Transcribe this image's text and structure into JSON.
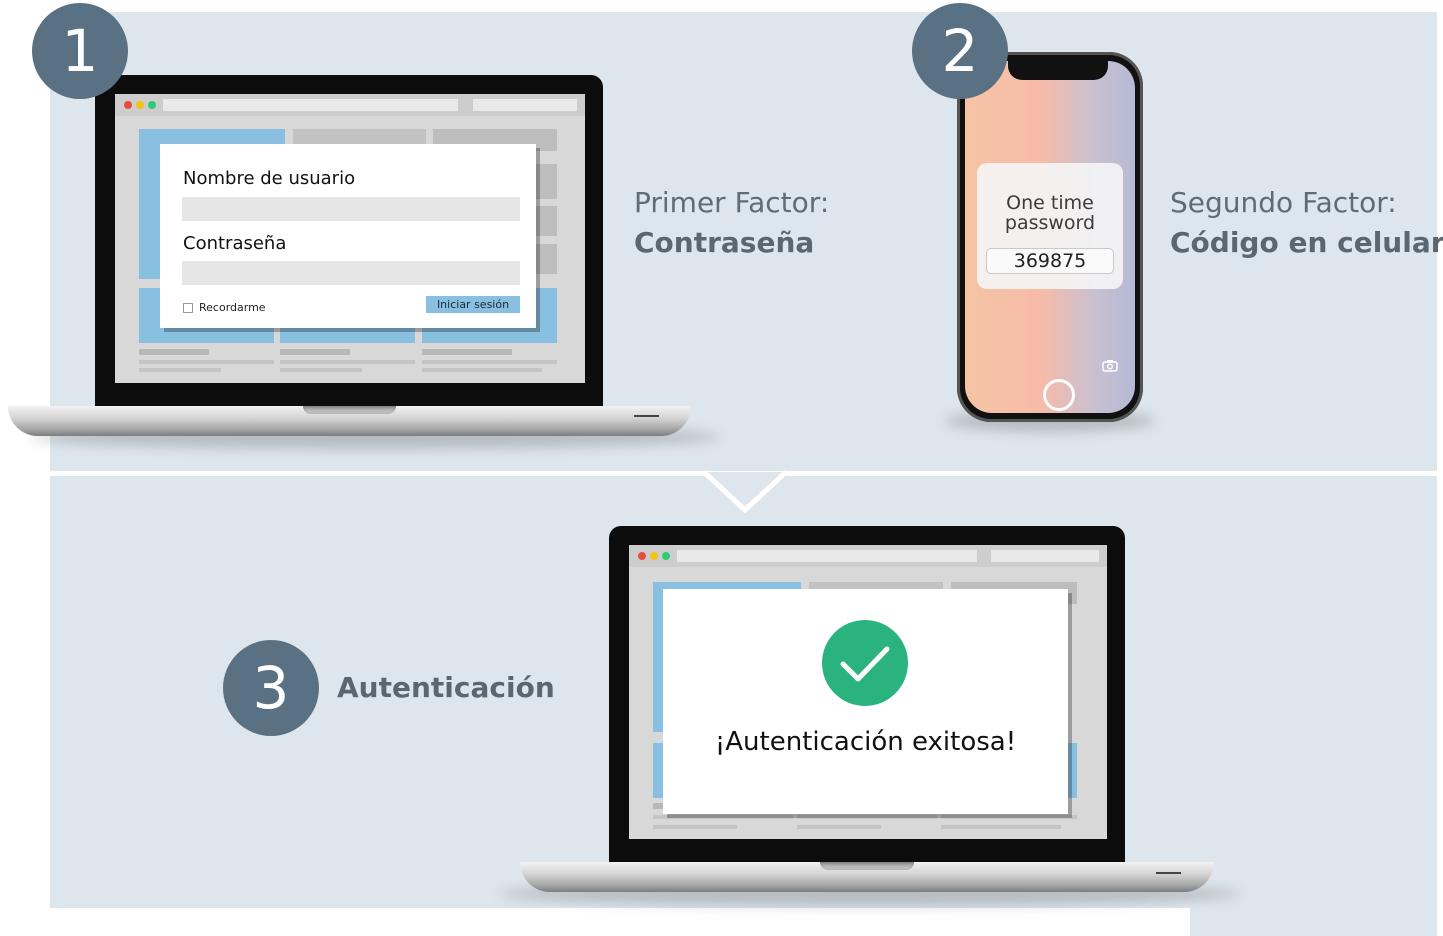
{
  "steps": [
    {
      "number": "1",
      "title": "Primer Factor:",
      "subtitle": "Contraseña"
    },
    {
      "number": "2",
      "title": "Segundo Factor:",
      "subtitle": "Código en celular"
    },
    {
      "number": "3",
      "title": "Autenticación"
    }
  ],
  "login_form": {
    "username_label": "Nombre de usuario",
    "password_label": "Contraseña",
    "remember_label": "Recordarme",
    "submit_label": "Iniciar sesión"
  },
  "phone": {
    "otp_line1": "One time",
    "otp_line2": "password",
    "otp_code": "369875"
  },
  "result": {
    "message": "¡Autenticación exitosa!"
  },
  "colors": {
    "panel_bg": "#dee6ed",
    "step_circle": "#5a7184",
    "accent_blue": "#89bfe0",
    "success_green": "#2bb37f"
  }
}
